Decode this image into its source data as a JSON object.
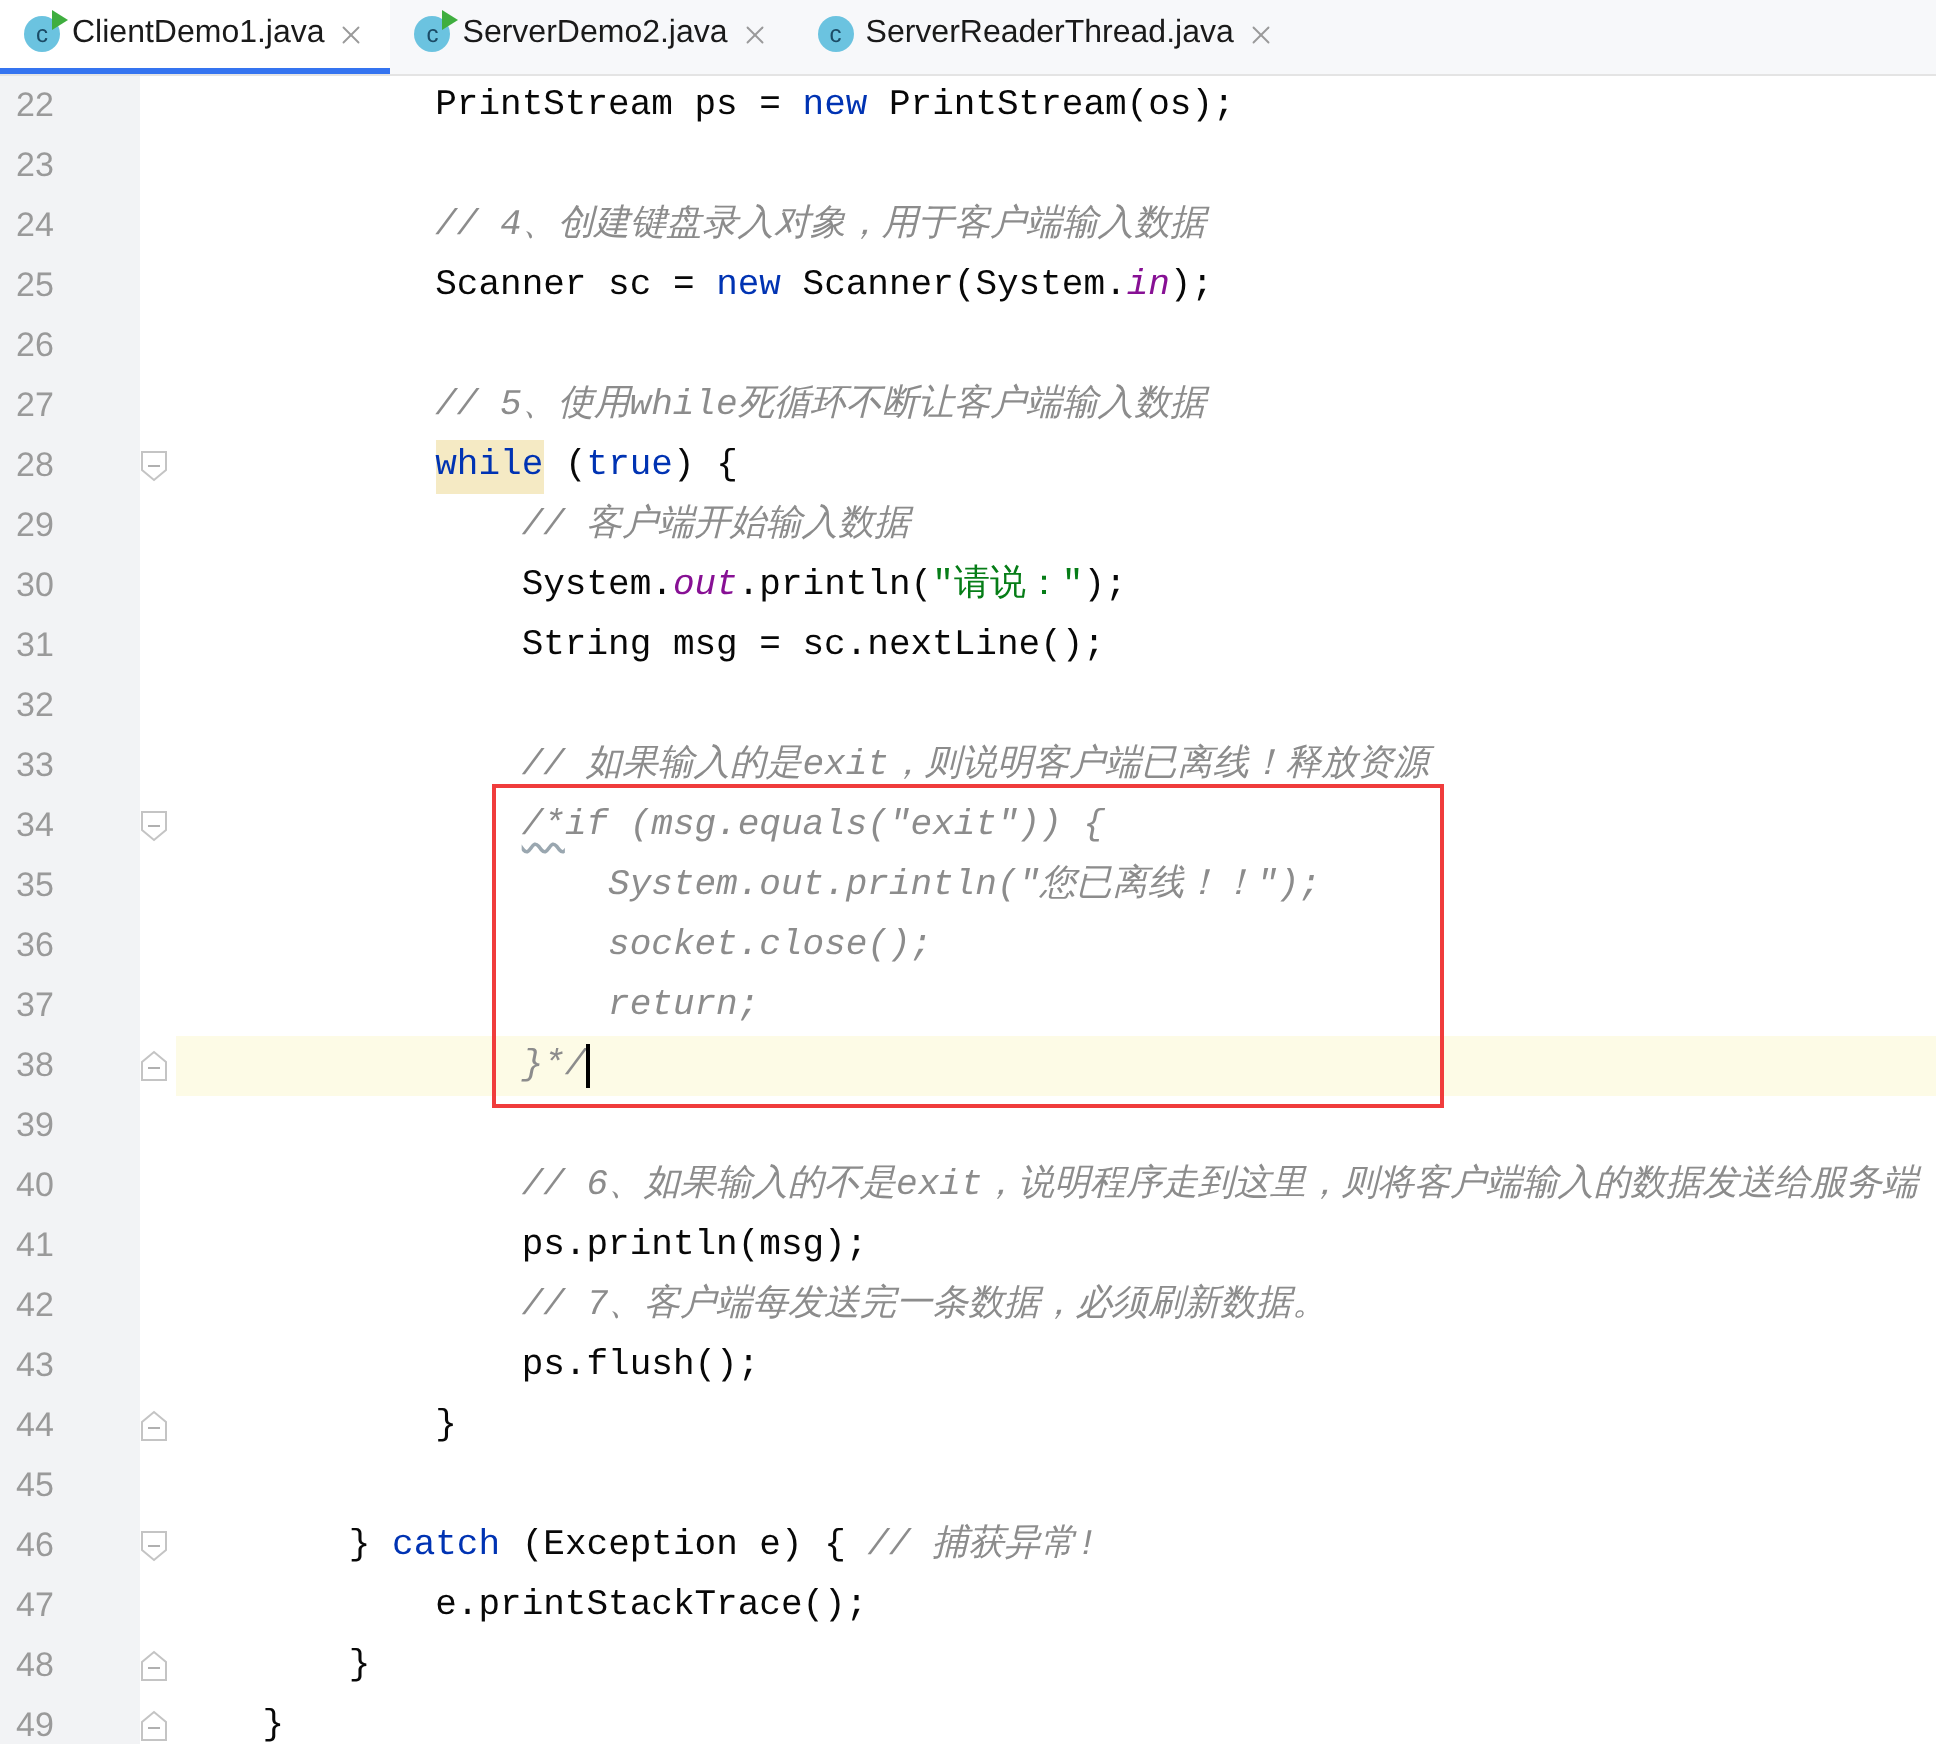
{
  "tabs": [
    {
      "label": "ClientDemo1.java",
      "icon_letter": "c",
      "runnable": true,
      "selected": true
    },
    {
      "label": "ServerDemo2.java",
      "icon_letter": "c",
      "runnable": true,
      "selected": false
    },
    {
      "label": "ServerReaderThread.java",
      "icon_letter": "c",
      "runnable": false,
      "selected": false
    }
  ],
  "lines": [
    {
      "number": "22",
      "tokens": [
        {
          "kind": "plain",
          "text": "            PrintStream ps = "
        },
        {
          "kind": "keyword",
          "text": "new"
        },
        {
          "kind": "plain",
          "text": " PrintStream(os);"
        }
      ]
    },
    {
      "number": "23"
    },
    {
      "number": "24",
      "tokens": [
        {
          "kind": "comment",
          "text": "            // 4、创建键盘录入对象，用于客户端输入数据"
        }
      ]
    },
    {
      "number": "25",
      "tokens": [
        {
          "kind": "plain",
          "text": "            Scanner sc = "
        },
        {
          "kind": "keyword",
          "text": "new"
        },
        {
          "kind": "plain",
          "text": " Scanner(System."
        },
        {
          "kind": "field",
          "text": "in"
        },
        {
          "kind": "plain",
          "text": ");"
        }
      ]
    },
    {
      "number": "26"
    },
    {
      "number": "27",
      "tokens": [
        {
          "kind": "comment",
          "text": "            // 5、使用while死循环不断让客户端输入数据"
        }
      ]
    },
    {
      "number": "28",
      "fold_start": true,
      "tokens": [
        {
          "kind": "keyword",
          "text": "            while",
          "highlighted": true
        },
        {
          "kind": "plain",
          "text": " ("
        },
        {
          "kind": "keyword",
          "text": "true"
        },
        {
          "kind": "plain",
          "text": ") {"
        }
      ]
    },
    {
      "number": "29",
      "tokens": [
        {
          "kind": "comment",
          "text": "                // 客户端开始输入数据"
        }
      ]
    },
    {
      "number": "30",
      "tokens": [
        {
          "kind": "plain",
          "text": "                System."
        },
        {
          "kind": "field",
          "text": "out"
        },
        {
          "kind": "plain",
          "text": ".println("
        },
        {
          "kind": "string",
          "text": "\"请说：\""
        },
        {
          "kind": "plain",
          "text": ");"
        }
      ]
    },
    {
      "number": "31",
      "tokens": [
        {
          "kind": "plain",
          "text": "                String msg = sc.nextLine();"
        }
      ]
    },
    {
      "number": "32"
    },
    {
      "number": "33",
      "tokens": [
        {
          "kind": "comment",
          "text": "                // 如果输入的是exit，则说明客户端已离线！释放资源"
        }
      ]
    },
    {
      "number": "34",
      "fold_start": true,
      "boxed": true,
      "tokens": [
        {
          "kind": "blockcomment",
          "text": "                /*",
          "warning": true
        },
        {
          "kind": "blockcomment",
          "text": "if (msg.equals(\"exit\")) {"
        }
      ]
    },
    {
      "number": "35",
      "boxed": true,
      "tokens": [
        {
          "kind": "blockcomment",
          "text": "                    System.out.println(\"您已离线！！\");"
        }
      ]
    },
    {
      "number": "36",
      "boxed": true,
      "tokens": [
        {
          "kind": "blockcomment",
          "text": "                    socket.close();"
        }
      ]
    },
    {
      "number": "37",
      "boxed": true,
      "tokens": [
        {
          "kind": "blockcomment",
          "text": "                    return;"
        }
      ]
    },
    {
      "number": "38",
      "fold_end": true,
      "boxed": true,
      "current": true,
      "tokens": [
        {
          "kind": "blockcomment",
          "text": "                }*/"
        }
      ]
    },
    {
      "number": "39"
    },
    {
      "number": "40",
      "tokens": [
        {
          "kind": "comment",
          "text": "                // 6、如果输入的不是exit，说明程序走到这里，则将客户端输入的数据发送给服务端"
        }
      ]
    },
    {
      "number": "41",
      "tokens": [
        {
          "kind": "plain",
          "text": "                ps.println(msg);"
        }
      ]
    },
    {
      "number": "42",
      "tokens": [
        {
          "kind": "comment",
          "text": "                // 7、客户端每发送完一条数据，必须刷新数据。"
        }
      ]
    },
    {
      "number": "43",
      "tokens": [
        {
          "kind": "plain",
          "text": "                ps.flush();"
        }
      ]
    },
    {
      "number": "44",
      "fold_end": true,
      "tokens": [
        {
          "kind": "plain",
          "text": "            }"
        }
      ]
    },
    {
      "number": "45"
    },
    {
      "number": "46",
      "fold_start": true,
      "tokens": [
        {
          "kind": "plain",
          "text": "        } "
        },
        {
          "kind": "keyword",
          "text": "catch"
        },
        {
          "kind": "plain",
          "text": " (Exception e) { "
        },
        {
          "kind": "comment",
          "text": "// 捕获异常!"
        }
      ]
    },
    {
      "number": "47",
      "tokens": [
        {
          "kind": "plain",
          "text": "            e.printStackTrace();"
        }
      ]
    },
    {
      "number": "48",
      "fold_end": true,
      "tokens": [
        {
          "kind": "plain",
          "text": "        }"
        }
      ]
    },
    {
      "number": "49",
      "fold_end": true,
      "tokens": [
        {
          "kind": "plain",
          "text": "    }"
        }
      ]
    }
  ]
}
